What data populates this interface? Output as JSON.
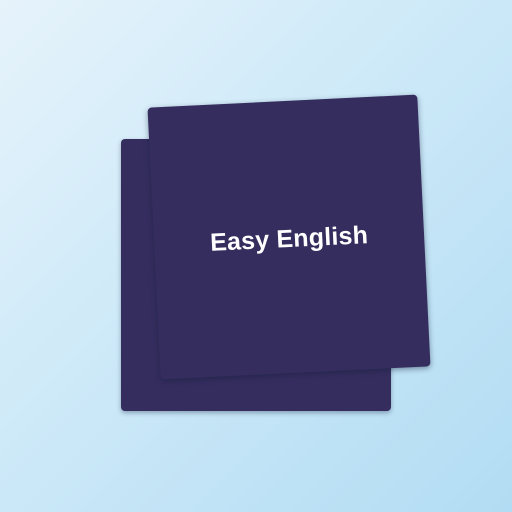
{
  "app": {
    "title": "Easy English"
  },
  "colors": {
    "card": "#352d5e",
    "background_light": "#e6f3fb",
    "background_dark": "#b2dcf3",
    "title_text": "#ffffff"
  }
}
